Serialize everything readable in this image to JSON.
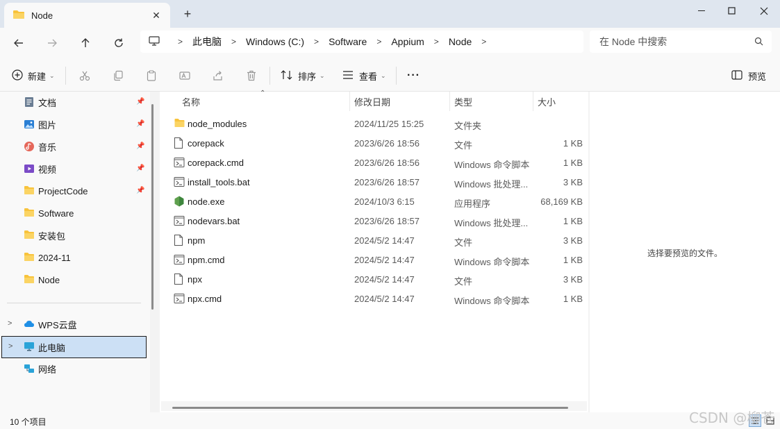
{
  "window": {
    "tab_title": "Node",
    "colors": {
      "accent": "#0067c0",
      "selection": "#cce0f5",
      "folder": "#f8c33c"
    }
  },
  "nav": {
    "breadcrumbs": [
      "此电脑",
      "Windows (C:)",
      "Software",
      "Appium",
      "Node"
    ],
    "search_placeholder": "在 Node 中搜索"
  },
  "toolbar": {
    "new_label": "新建",
    "sort_label": "排序",
    "view_label": "查看",
    "more_label": "···",
    "preview_label": "预览"
  },
  "sidebar": {
    "quick_access": [
      {
        "label": "文档",
        "icon": "documents-icon",
        "pinned": true
      },
      {
        "label": "图片",
        "icon": "pictures-icon",
        "pinned": true
      },
      {
        "label": "音乐",
        "icon": "music-icon",
        "pinned": true
      },
      {
        "label": "视频",
        "icon": "videos-icon",
        "pinned": true
      },
      {
        "label": "ProjectCode",
        "icon": "folder-icon",
        "pinned": true
      },
      {
        "label": "Software",
        "icon": "folder-icon",
        "pinned": false
      },
      {
        "label": "安装包",
        "icon": "folder-icon",
        "pinned": false
      },
      {
        "label": "2024-11",
        "icon": "folder-icon",
        "pinned": false
      },
      {
        "label": "Node",
        "icon": "folder-icon",
        "pinned": false
      }
    ],
    "locations": [
      {
        "label": "WPS云盘",
        "icon": "cloud-icon",
        "expandable": true,
        "selected": false
      },
      {
        "label": "此电脑",
        "icon": "computer-icon",
        "expandable": true,
        "selected": true
      },
      {
        "label": "网络",
        "icon": "network-icon",
        "expandable": false,
        "selected": false
      }
    ]
  },
  "filelist": {
    "columns": [
      "名称",
      "修改日期",
      "类型",
      "大小"
    ],
    "rows": [
      {
        "name": "node_modules",
        "date": "2024/11/25 15:25",
        "type": "文件夹",
        "size": "",
        "icon": "folder-icon"
      },
      {
        "name": "corepack",
        "date": "2023/6/26 18:56",
        "type": "文件",
        "size": "1 KB",
        "icon": "file-icon"
      },
      {
        "name": "corepack.cmd",
        "date": "2023/6/26 18:56",
        "type": "Windows 命令脚本",
        "size": "1 KB",
        "icon": "script-icon"
      },
      {
        "name": "install_tools.bat",
        "date": "2023/6/26 18:57",
        "type": "Windows 批处理...",
        "size": "3 KB",
        "icon": "script-icon"
      },
      {
        "name": "node.exe",
        "date": "2024/10/3 6:15",
        "type": "应用程序",
        "size": "68,169 KB",
        "icon": "nodejs-icon"
      },
      {
        "name": "nodevars.bat",
        "date": "2023/6/26 18:57",
        "type": "Windows 批处理...",
        "size": "1 KB",
        "icon": "script-icon"
      },
      {
        "name": "npm",
        "date": "2024/5/2 14:47",
        "type": "文件",
        "size": "3 KB",
        "icon": "file-icon"
      },
      {
        "name": "npm.cmd",
        "date": "2024/5/2 14:47",
        "type": "Windows 命令脚本",
        "size": "1 KB",
        "icon": "script-icon"
      },
      {
        "name": "npx",
        "date": "2024/5/2 14:47",
        "type": "文件",
        "size": "3 KB",
        "icon": "file-icon"
      },
      {
        "name": "npx.cmd",
        "date": "2024/5/2 14:47",
        "type": "Windows 命令脚本",
        "size": "1 KB",
        "icon": "script-icon"
      }
    ]
  },
  "preview": {
    "empty_text": "选择要预览的文件。"
  },
  "status": {
    "item_count": "10 个项目"
  },
  "watermark": "CSDN @柳苍"
}
